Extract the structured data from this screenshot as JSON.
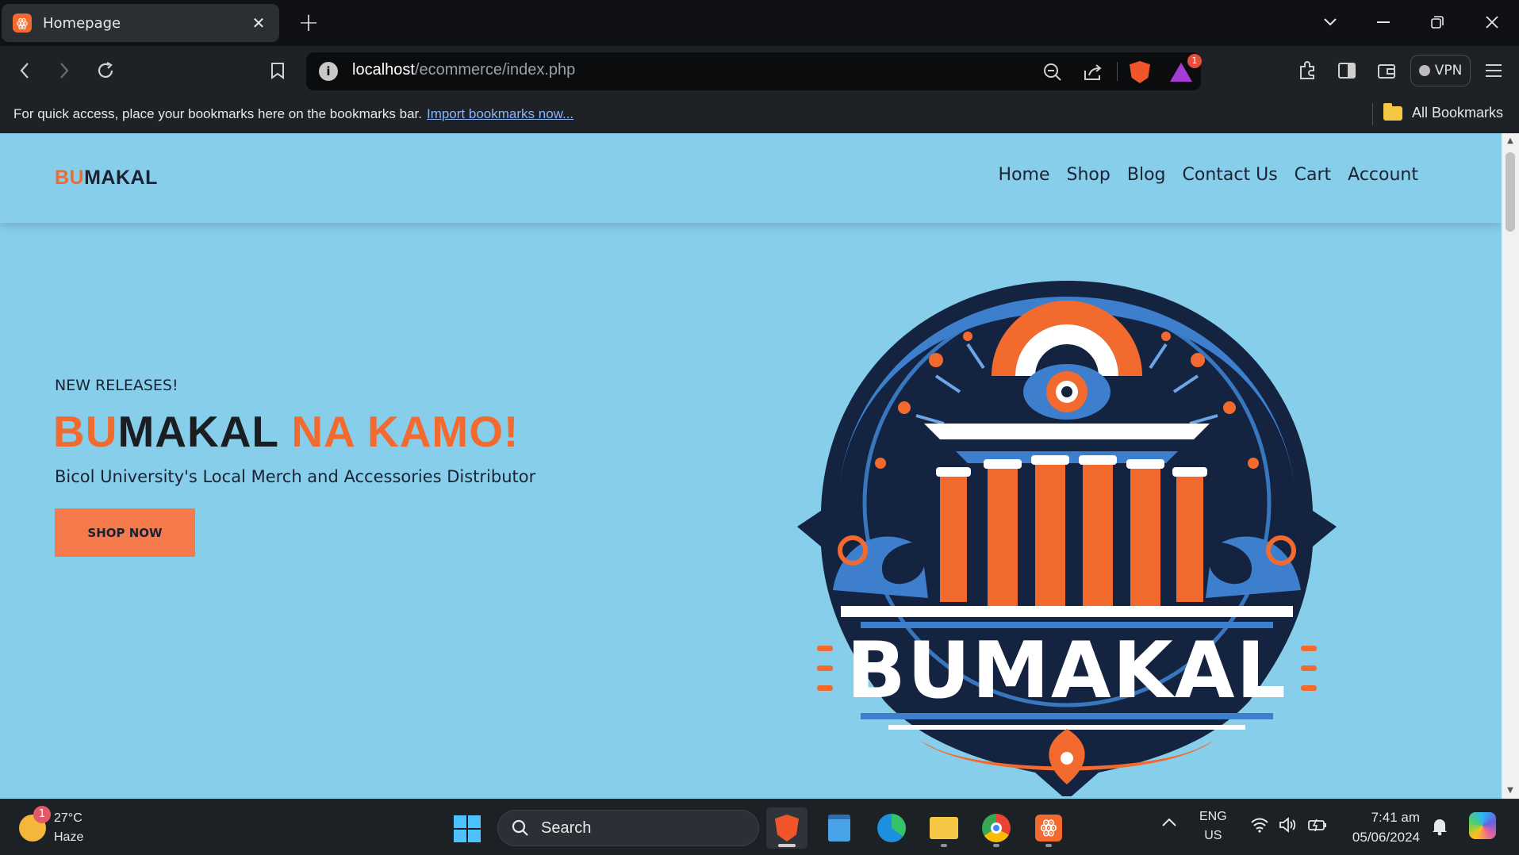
{
  "browser": {
    "tab_title": "Homepage",
    "url_host": "localhost",
    "url_path": "/ecommerce/index.php",
    "rewards_badge": "1",
    "vpn_label": "VPN",
    "bookmarks_hint": "For quick access, place your bookmarks here on the bookmarks bar.",
    "import_link": "Import bookmarks now...",
    "all_bookmarks": "All Bookmarks"
  },
  "site": {
    "logo_bu": "BU",
    "logo_makal": "MAKAL",
    "nav": [
      "Home",
      "Shop",
      "Blog",
      "Contact Us",
      "Cart",
      "Account"
    ],
    "hero": {
      "eyebrow": "NEW RELEASES!",
      "title_bu": "BU",
      "title_makal": "MAKAL",
      "title_rest": "NA KAMO!",
      "description": "Bicol University's Local Merch and Accessories Distributor",
      "cta": "SHOP NOW"
    },
    "emblem_text": "BUMAKAL",
    "colors": {
      "accent": "#f26a2e",
      "background": "#87ceeb",
      "dark": "#1a2233"
    }
  },
  "taskbar": {
    "weather_badge": "1",
    "temperature": "27°C",
    "condition": "Haze",
    "search_placeholder": "Search",
    "lang_top": "ENG",
    "lang_bottom": "US",
    "time": "7:41 am",
    "date": "05/06/2024"
  }
}
